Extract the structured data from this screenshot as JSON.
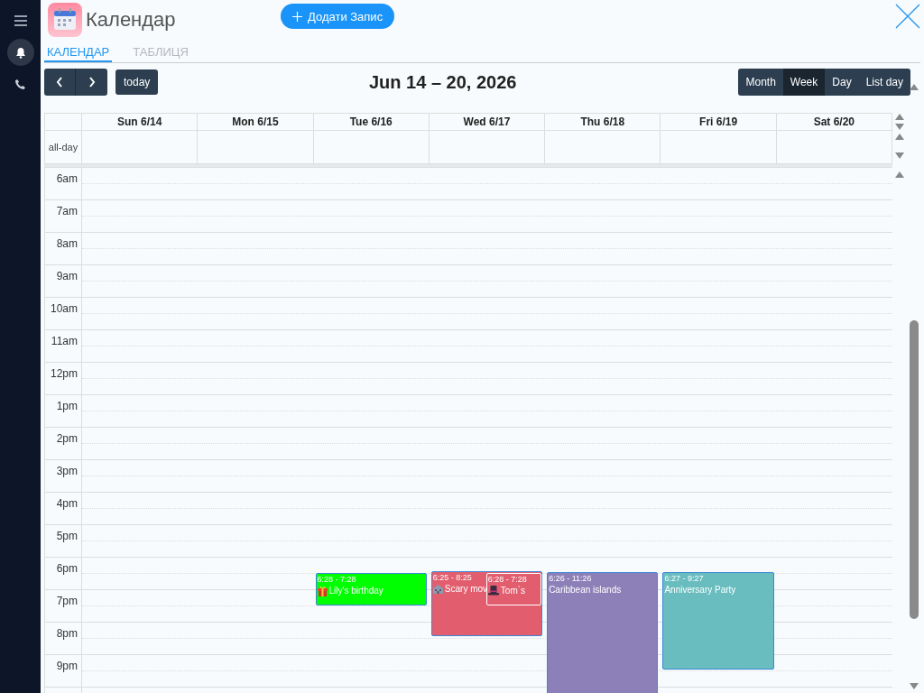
{
  "app": {
    "title": "Календар",
    "add_button": "Додати Запис"
  },
  "tabs": [
    {
      "label": "КАЛЕНДАР",
      "selected": true
    },
    {
      "label": "ТАБЛИЦЯ",
      "selected": false
    }
  ],
  "toolbar": {
    "today": "today",
    "range_title": "Jun 14 – 20, 2026",
    "views": [
      {
        "label": "Month",
        "selected": false
      },
      {
        "label": "Week",
        "selected": true
      },
      {
        "label": "Day",
        "selected": false
      },
      {
        "label": "List day",
        "selected": false
      }
    ]
  },
  "calendar": {
    "all_day_label": "all-day",
    "hours": [
      "6am",
      "7am",
      "8am",
      "9am",
      "10am",
      "11am",
      "12pm",
      "1pm",
      "2pm",
      "3pm",
      "4pm",
      "5pm",
      "6pm",
      "7pm",
      "8pm",
      "9pm"
    ],
    "days": [
      {
        "label": "Sun 6/14"
      },
      {
        "label": "Mon 6/15"
      },
      {
        "label": "Tue 6/16",
        "events": [
          {
            "time": "6:28 - 7:28",
            "title": "Lily's birthday",
            "kind": "gift",
            "color": "#00ff00"
          }
        ]
      },
      {
        "label": "Wed 6/17",
        "events": [
          {
            "time": "6:25 - 8:25",
            "title": "Scary mov",
            "kind": "cinema",
            "color": "#e25e6e"
          },
          {
            "time": "6:28 - 7:28",
            "title": "Tom`s",
            "kind": "hat",
            "color": "#e25e6e"
          }
        ]
      },
      {
        "label": "Thu 6/18",
        "events": [
          {
            "time": "6:26 - 11:26",
            "title": "Caribbean islands",
            "kind": "plain",
            "color": "#8d80b9"
          }
        ]
      },
      {
        "label": "Fri 6/19",
        "events": [
          {
            "time": "6:27 - 9:27",
            "title": "Anniversary Party",
            "kind": "plain",
            "color": "#69bdbf"
          }
        ]
      },
      {
        "label": "Sat 6/20"
      }
    ]
  }
}
